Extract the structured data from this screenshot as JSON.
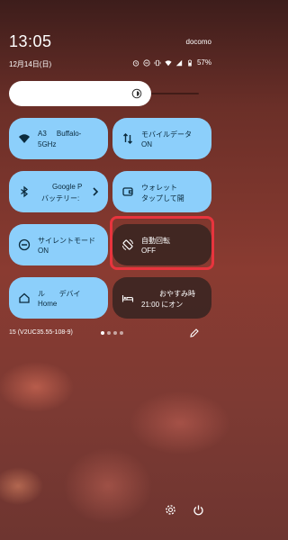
{
  "status": {
    "time": "13:05",
    "carrier": "docomo",
    "date": "12月14日(日)",
    "battery": "57%",
    "icons": [
      "alarm-icon",
      "do-not-disturb-icon",
      "vibrate-icon",
      "wifi-icon",
      "signal-icon",
      "battery-icon"
    ]
  },
  "brightness": {
    "level": 0.72
  },
  "tiles": [
    {
      "name": "wifi",
      "line1": "A3",
      "line1b": "Buffalo-",
      "line2": "5GHz",
      "on": true,
      "chevron": false
    },
    {
      "name": "mobile-data",
      "line1": "モバイルデータ",
      "line2": "ON",
      "on": true,
      "chevron": false
    },
    {
      "name": "bluetooth",
      "line1": "Google P",
      "line2": "バッテリー:",
      "on": true,
      "chevron": true
    },
    {
      "name": "wallet",
      "line1": "ウォレット",
      "line2": "タップして開",
      "on": true,
      "chevron": false
    },
    {
      "name": "silent-mode",
      "line1": "サイレントモード",
      "line2": "ON",
      "on": true,
      "chevron": false
    },
    {
      "name": "auto-rotate",
      "line1": "自動回転",
      "line2": "OFF",
      "on": false,
      "chevron": false
    },
    {
      "name": "home",
      "line1": "ル",
      "line1b": "デバイ",
      "line2": "Home",
      "on": true,
      "chevron": false
    },
    {
      "name": "bedtime",
      "line1": "おやすみ時",
      "line2": "21:00 にオン",
      "on": false,
      "chevron": false
    }
  ],
  "footer": {
    "build": "15 (V2UC35.55-108-9)",
    "page_count": 4,
    "active_page": 0
  },
  "colors": {
    "tile_on": "#8ccffb",
    "tile_off": "#3c2622",
    "highlight": "#e8343d"
  }
}
